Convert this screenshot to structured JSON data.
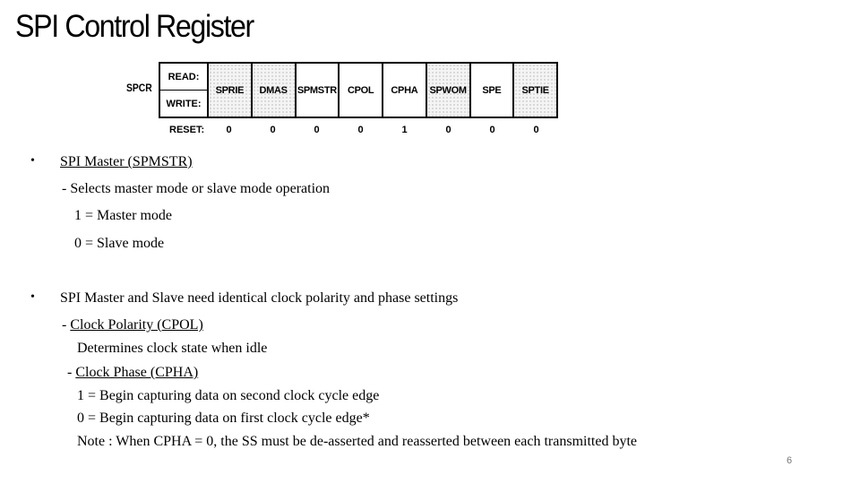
{
  "slide": {
    "title": "SPI Control Register",
    "page_number": "6"
  },
  "register": {
    "name": "SPCR",
    "read_label": "READ:",
    "write_label": "WRITE:",
    "reset_label": "RESET:",
    "bits": [
      {
        "name": "SPRIE",
        "reset": "0",
        "shaded": true
      },
      {
        "name": "DMAS",
        "reset": "0",
        "shaded": true
      },
      {
        "name": "SPMSTR",
        "reset": "0",
        "shaded": false
      },
      {
        "name": "CPOL",
        "reset": "0",
        "shaded": false
      },
      {
        "name": "CPHA",
        "reset": "1",
        "shaded": false
      },
      {
        "name": "SPWOM",
        "reset": "0",
        "shaded": true
      },
      {
        "name": "SPE",
        "reset": "0",
        "shaded": false
      },
      {
        "name": "SPTIE",
        "reset": "0",
        "shaded": true
      }
    ]
  },
  "content": {
    "bullet1": {
      "bullet": "•",
      "heading": "SPI Master (SPMSTR)",
      "desc": "- Selects master mode or slave mode operation",
      "opt1": "1 = Master mode",
      "opt0": "0 = Slave mode"
    },
    "bullet2": {
      "bullet": "•",
      "heading": "SPI Master and Slave need identical clock polarity and phase settings",
      "cpol_dash": "- ",
      "cpol_heading": "Clock Polarity (CPOL)",
      "cpol_desc": "Determines clock state when idle",
      "cpha_dash": "- ",
      "cpha_heading": "Clock Phase (CPHA)",
      "cpha_opt1": "1 = Begin capturing data on second clock cycle edge",
      "cpha_opt0": "0 = Begin capturing data on first clock cycle edge*",
      "note": "Note : When CPHA = 0, the SS must be de-asserted and reasserted between each transmitted byte"
    }
  }
}
